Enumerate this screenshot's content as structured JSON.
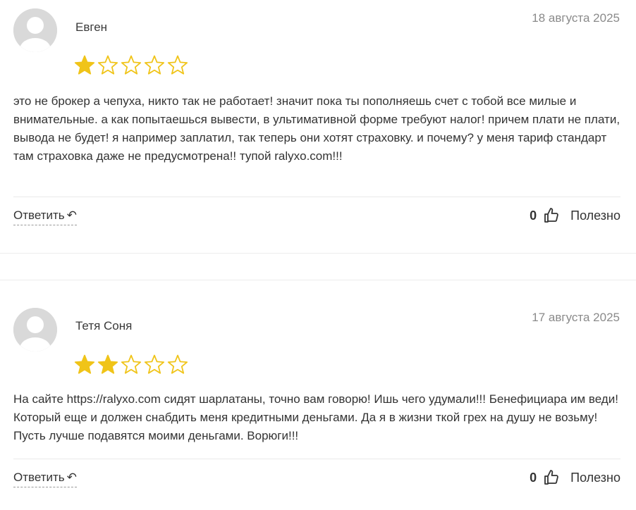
{
  "reviews": [
    {
      "author": "Евген",
      "date": "18 августа 2025",
      "rating": 1,
      "max_rating": 5,
      "text": "это не брокер а чепуха, никто так не работает! значит пока ты пополняешь счет с тобой все милые и внимательные. а как попытаешься вывести, в ультимативной форме требуют налог! причем плати не плати, вывода не будет! я например заплатил, так теперь они хотят страховку. и почему? у меня тариф стандарт там страховка даже не предусмотрена!! тупой ralyxo.com!!!",
      "reply_label": "Ответить",
      "reply_arrow": "↵",
      "helpful_count": "0",
      "helpful_label": "Полезно"
    },
    {
      "author": "Тетя Соня",
      "date": "17 августа 2025",
      "rating": 2,
      "max_rating": 5,
      "text": "На сайте https://ralyxo.com сидят шарлатаны, точно вам говорю! Ишь чего удумали!!! Бенефициара им веди! Который еще и должен снабдить меня кредитными деньгами. Да я в жизни ткой грех на душу не возьму! Пусть лучше подавятся моими деньгами. Ворюги!!!",
      "reply_label": "Ответить",
      "reply_arrow": "↵",
      "helpful_count": "0",
      "helpful_label": "Полезно"
    }
  ],
  "colors": {
    "star_filled": "#f0c419",
    "star_empty": "#f0c419",
    "avatar_bg": "#d9d9d9"
  },
  "icons": {
    "avatar": "user-avatar-icon",
    "star": "star-icon",
    "thumb": "thumbs-up-icon",
    "reply": "reply-arrow-icon"
  }
}
